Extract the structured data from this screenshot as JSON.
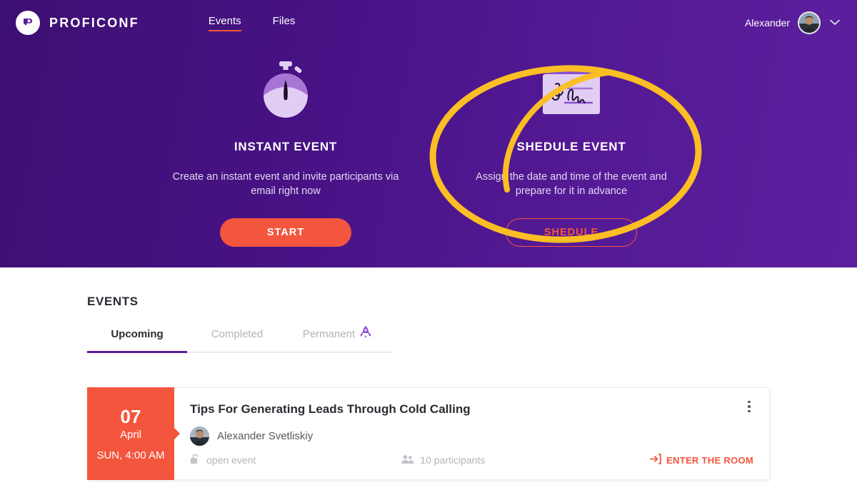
{
  "brand": {
    "name": "PROFICONF",
    "logo_icon": "proficonf-p-logo-icon"
  },
  "nav": {
    "links": [
      {
        "label": "Events",
        "active": true
      },
      {
        "label": "Files",
        "active": false
      }
    ],
    "user": {
      "name": "Alexander",
      "avatar_icon": "user-avatar",
      "chevron_icon": "chevron-down-icon"
    }
  },
  "hero": {
    "cards": [
      {
        "icon": "stopwatch-icon",
        "title": "INSTANT EVENT",
        "description": "Create an instant event and invite participants via email right now",
        "button": "START",
        "button_style": "filled"
      },
      {
        "icon": "signed-note-icon",
        "title": "SHEDULE EVENT",
        "description": "Assign the date and time of the event and prepare for it in advance",
        "button": "SHEDULE",
        "button_style": "outline"
      }
    ],
    "annotation": {
      "shape": "hand-drawn-ellipse",
      "color": "#FBBE25",
      "target": "SHEDULE EVENT"
    }
  },
  "events_section": {
    "title": "EVENTS",
    "tabs": [
      {
        "label": "Upcoming",
        "active": true,
        "icon": null
      },
      {
        "label": "Completed",
        "active": false,
        "icon": null
      },
      {
        "label": "Permanent",
        "active": false,
        "icon": "rocket-icon"
      }
    ],
    "cards": [
      {
        "date": {
          "day": "07",
          "month": "April",
          "time": "SUN, 4:00 AM"
        },
        "title": "Tips For Generating Leads Through Cold Calling",
        "host": {
          "name": "Alexander Svetliskiy",
          "avatar_icon": "user-avatar"
        },
        "access": {
          "label": "open event",
          "icon": "unlock-icon"
        },
        "participants": {
          "label": "10 participants",
          "icon": "participants-icon"
        },
        "enter": {
          "label": "ENTER THE ROOM",
          "icon": "enter-room-icon"
        },
        "menu_icon": "kebab-menu-icon"
      }
    ]
  },
  "colors": {
    "hero_purple_dark": "#3D1073",
    "hero_purple_light": "#5D1F9E",
    "accent_coral": "#F4553D",
    "tab_active_purple": "#5B1D9C",
    "annotation_yellow": "#FBBE25"
  }
}
